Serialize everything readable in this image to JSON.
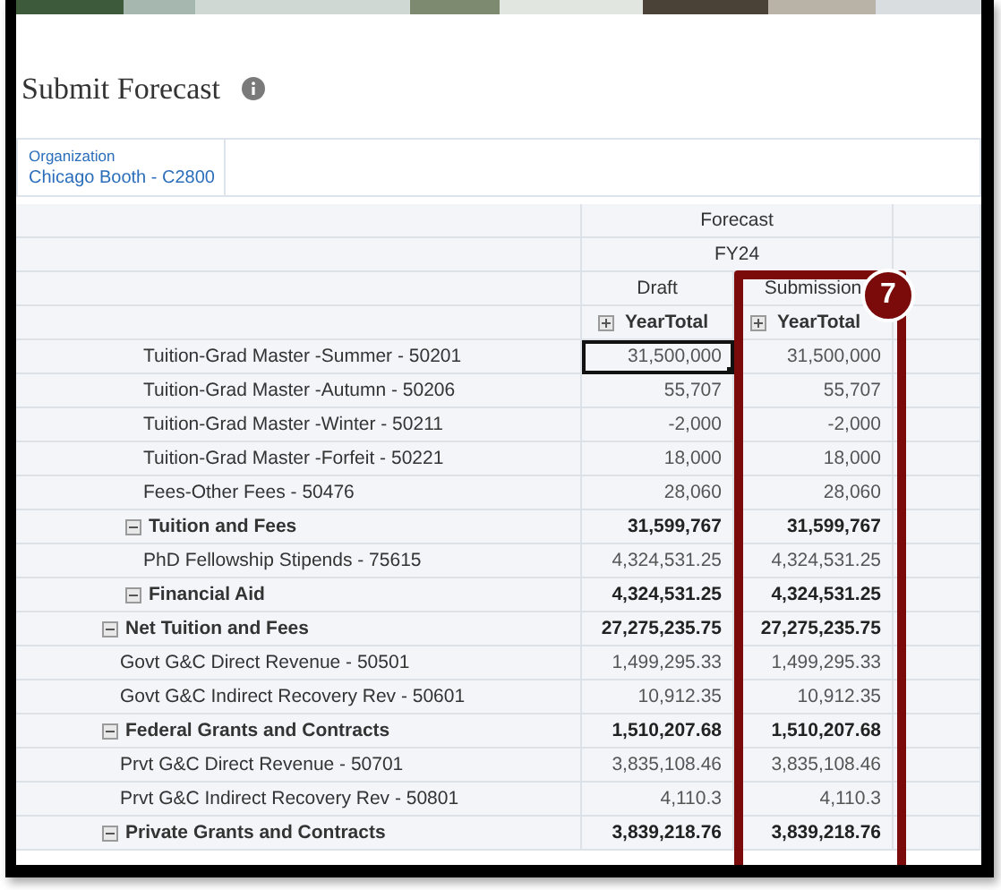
{
  "window": {
    "title": "Submit Forecast"
  },
  "pov": {
    "label": "Organization",
    "value": "Chicago Booth - C2800"
  },
  "grid": {
    "scenario": "Forecast",
    "year": "FY24",
    "columns": [
      {
        "version": "Draft",
        "period": "YearTotal",
        "expanded": false
      },
      {
        "version": "Submission",
        "period": "YearTotal",
        "expanded": false
      }
    ],
    "rows": [
      {
        "label": "Net Tuition and Fees",
        "kind": "total",
        "expanded": true,
        "cells": [
          {
            "text": "27,275,235.75",
            "selected": false
          },
          {
            "text": "27,275,235.75",
            "selected": false
          }
        ],
        "children": [
          {
            "label": "Tuition and Fees",
            "kind": "total",
            "expanded": true,
            "cells": [
              {
                "text": "31,599,767",
                "selected": false
              },
              {
                "text": "31,599,767",
                "selected": false
              }
            ],
            "children": [
              {
                "label": "Tuition-Grad Master -Summer - 50201",
                "kind": "account",
                "cells": [
                  {
                    "text": "31,500,000",
                    "selected": true
                  },
                  {
                    "text": "31,500,000",
                    "selected": false
                  }
                ]
              },
              {
                "label": "Tuition-Grad Master -Autumn - 50206",
                "kind": "account",
                "cells": [
                  {
                    "text": "55,707",
                    "selected": false
                  },
                  {
                    "text": "55,707",
                    "selected": false
                  }
                ]
              },
              {
                "label": "Tuition-Grad Master -Winter - 50211",
                "kind": "account",
                "cells": [
                  {
                    "text": "-2,000",
                    "selected": false
                  },
                  {
                    "text": "-2,000",
                    "selected": false
                  }
                ]
              },
              {
                "label": "Tuition-Grad Master -Forfeit - 50221",
                "kind": "account",
                "cells": [
                  {
                    "text": "18,000",
                    "selected": false
                  },
                  {
                    "text": "18,000",
                    "selected": false
                  }
                ]
              },
              {
                "label": "Fees-Other Fees - 50476",
                "kind": "account",
                "cells": [
                  {
                    "text": "28,060",
                    "selected": false
                  },
                  {
                    "text": "28,060",
                    "selected": false
                  }
                ]
              }
            ]
          },
          {
            "label": "Financial Aid",
            "kind": "total",
            "expanded": true,
            "cells": [
              {
                "text": "4,324,531.25",
                "selected": false
              },
              {
                "text": "4,324,531.25",
                "selected": false
              }
            ],
            "children": [
              {
                "label": "PhD Fellowship Stipends - 75615",
                "kind": "account",
                "cells": [
                  {
                    "text": "4,324,531.25",
                    "selected": false
                  },
                  {
                    "text": "4,324,531.25",
                    "selected": false
                  }
                ]
              }
            ]
          }
        ]
      },
      {
        "label": "Federal Grants and Contracts",
        "kind": "total",
        "expanded": true,
        "cells": [
          {
            "text": "1,510,207.68",
            "selected": false
          },
          {
            "text": "1,510,207.68",
            "selected": false
          }
        ],
        "children": [
          {
            "label": "Govt G&C Direct Revenue - 50501",
            "kind": "account",
            "cells": [
              {
                "text": "1,499,295.33",
                "selected": false
              },
              {
                "text": "1,499,295.33",
                "selected": false
              }
            ]
          },
          {
            "label": "Govt G&C Indirect Recovery Rev - 50601",
            "kind": "account",
            "cells": [
              {
                "text": "10,912.35",
                "selected": false
              },
              {
                "text": "10,912.35",
                "selected": false
              }
            ]
          }
        ]
      },
      {
        "label": "Private Grants and Contracts",
        "kind": "total",
        "expanded": true,
        "cells": [
          {
            "text": "3,839,218.76",
            "selected": false
          },
          {
            "text": "3,839,218.76",
            "selected": false
          }
        ],
        "children": [
          {
            "label": "Prvt G&C Direct Revenue - 50701",
            "kind": "account",
            "cells": [
              {
                "text": "3,835,108.46",
                "selected": false
              },
              {
                "text": "3,835,108.46",
                "selected": false
              }
            ]
          },
          {
            "label": "Prvt G&C Indirect Recovery Rev - 50801",
            "kind": "account",
            "cells": [
              {
                "text": "4,110.3",
                "selected": false
              },
              {
                "text": "4,110.3",
                "selected": false
              }
            ]
          }
        ]
      }
    ]
  },
  "callout": {
    "number": "7"
  }
}
